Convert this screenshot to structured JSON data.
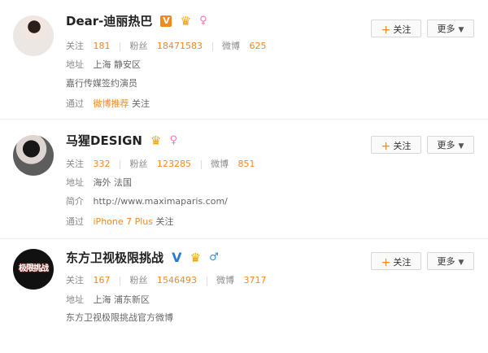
{
  "users": [
    {
      "name": "Dear-迪丽热巴",
      "badges": [
        "V",
        "会员",
        "♀"
      ],
      "stats": {
        "follow_label": "关注",
        "follow_count": "181",
        "fans_label": "粉丝",
        "fans_count": "18471583",
        "weibo_label": "微博",
        "weibo_count": "625"
      },
      "line2": {
        "label": "地址",
        "value": "上海 静安区"
      },
      "line3": {
        "text": "嘉行传媒签约演员"
      },
      "line4": {
        "prefix": "通过",
        "link": "微博推荐",
        "suffix": "关注"
      },
      "buttons": {
        "follow": "关注",
        "more": "更多"
      }
    },
    {
      "name": "马猩DESIGN",
      "badges": [
        "会员",
        "♀"
      ],
      "stats": {
        "follow_label": "关注",
        "follow_count": "332",
        "fans_label": "粉丝",
        "fans_count": "123285",
        "weibo_label": "微博",
        "weibo_count": "851"
      },
      "line2": {
        "label": "地址",
        "value": "海外 法国"
      },
      "line3": {
        "label": "简介",
        "value": "http://www.maximaparis.com/"
      },
      "line4": {
        "prefix": "通过",
        "link": "iPhone 7 Plus",
        "suffix": "关注"
      },
      "buttons": {
        "follow": "关注",
        "more": "更多"
      }
    },
    {
      "name": "东方卫视极限挑战",
      "badges": [
        "V",
        "会员",
        "♂"
      ],
      "stats": {
        "follow_label": "关注",
        "follow_count": "167",
        "fans_label": "粉丝",
        "fans_count": "1546493",
        "weibo_label": "微博",
        "weibo_count": "3717"
      },
      "line2": {
        "label": "地址",
        "value": "上海 浦东新区"
      },
      "line3": {
        "text": "东方卫视极限挑战官方微博"
      },
      "avatar_text": "极限挑战",
      "buttons": {
        "follow": "关注",
        "more": "更多"
      }
    }
  ],
  "colors": {
    "accent": "#f08a24",
    "verified_orange": "#f28a1a",
    "verified_blue": "#2a7bd1",
    "divider": "#eeeeee"
  }
}
